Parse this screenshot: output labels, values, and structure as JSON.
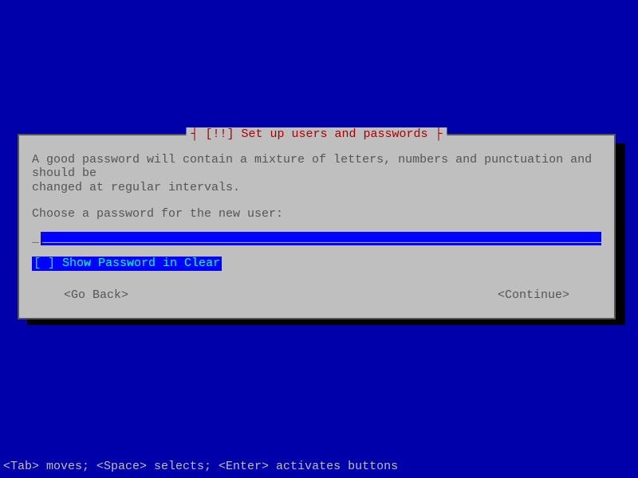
{
  "dialog": {
    "title": "[!!] Set up users and passwords",
    "body": "A good password will contain a mixture of letters, numbers and punctuation and should be\nchanged at regular intervals.",
    "prompt": "Choose a password for the new user:",
    "password_value": "",
    "password_mask": "________________________________________________________________________________________________",
    "checkbox": {
      "marker": "[ ]",
      "label": "Show Password in Clear"
    },
    "go_back": "<Go Back>",
    "continue": "<Continue>"
  },
  "statusbar": "<Tab> moves; <Space> selects; <Enter> activates buttons"
}
